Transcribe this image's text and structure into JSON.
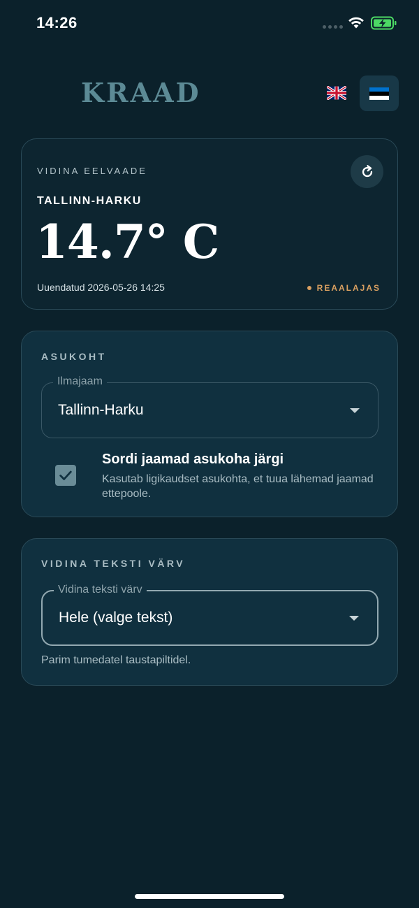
{
  "status_bar": {
    "time": "14:26"
  },
  "header": {
    "logo": "KRAAD",
    "languages": [
      {
        "code": "en",
        "icon": "uk-flag-icon"
      },
      {
        "code": "et",
        "icon": "estonia-flag-icon",
        "selected": true
      }
    ]
  },
  "preview": {
    "eyebrow": "VIDINA EELVAADE",
    "station": "TALLINN-HARKU",
    "temperature": "14.7° C",
    "updated": "Uuendatud 2026-05-26 14:25",
    "realtime_label": "REAALAJAS",
    "refresh_icon": "refresh-icon"
  },
  "location": {
    "title": "ASUKOHT",
    "field_label": "Ilmajaam",
    "field_value": "Tallinn-Harku",
    "sort_checked": true,
    "sort_title": "Sordi jaamad asukoha järgi",
    "sort_description": "Kasutab ligikaudset asukohta, et tuua lähemad jaamad ettepoole."
  },
  "text_color": {
    "title": "VIDINA TEKSTI VÄRV",
    "field_label": "Vidina teksti värv",
    "field_value": "Hele (valge tekst)",
    "helper": "Parim tumedatel taustapiltidel."
  },
  "colors": {
    "background": "#0b212b",
    "card": "#10303f",
    "accent_logo": "#5c8a95",
    "realtime": "#d9a061",
    "checkbox": "#6a8c97"
  }
}
